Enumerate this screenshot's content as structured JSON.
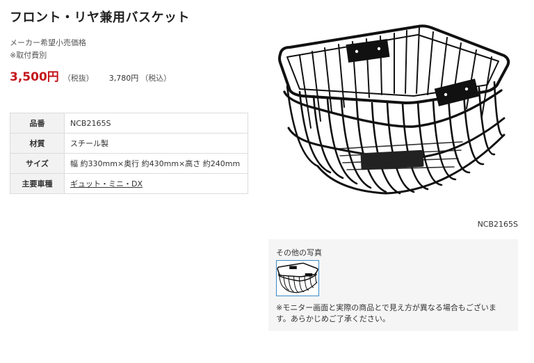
{
  "product": {
    "title": "フロント・リヤ兼用バスケット",
    "price_note_1": "メーカー希望小売価格",
    "price_note_2": "※取付費別",
    "price_main": "3,500円",
    "tax_excluded_label": "（税抜）",
    "price_incl": "3,780円",
    "tax_included_label": "（税込）"
  },
  "specs": [
    {
      "label": "品番",
      "value": "NCB2165S"
    },
    {
      "label": "材質",
      "value": "スチール製"
    },
    {
      "label": "サイズ",
      "value": "幅 約330mm×奥行 約430mm×高さ 約240mm"
    },
    {
      "label": "主要車種",
      "value": "ギュット・ミニ・DX"
    }
  ],
  "image": {
    "caption": "NCB2165S",
    "alt": "バスケット"
  },
  "other_photos": {
    "title": "その他の写真",
    "note": "※モニター画面と実際の商品とで見え方が異なる場合もございます。あらかじめご了承ください。"
  },
  "colors": {
    "price": "#c4161c",
    "basket": "#111111",
    "thumb_border": "#3a8ac8"
  }
}
